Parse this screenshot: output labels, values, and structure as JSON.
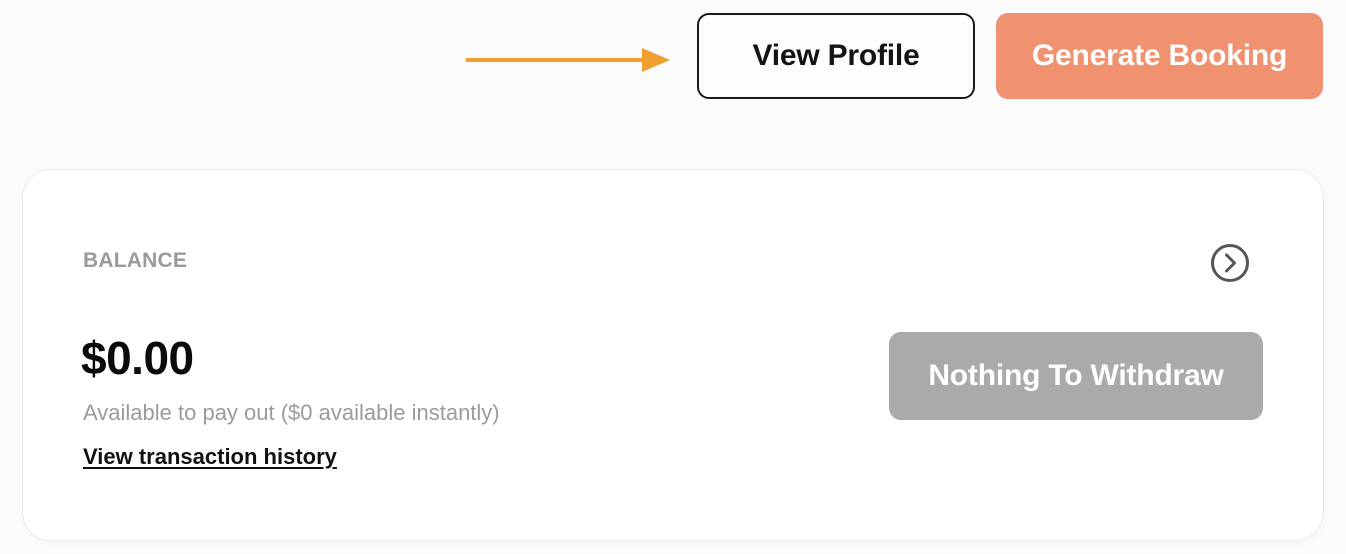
{
  "header": {
    "view_profile_label": "View Profile",
    "generate_booking_label": "Generate Booking"
  },
  "balance_card": {
    "label": "BALANCE",
    "amount": "$0.00",
    "available_text": "Available to pay out ($0 available instantly)",
    "history_link": "View transaction history",
    "withdraw_label": "Nothing To Withdraw",
    "details_icon": "chevron-right-circle-icon"
  },
  "colors": {
    "annotation_arrow": "#f0a030",
    "primary": "#f0926f",
    "disabled": "#aaaaaa"
  }
}
